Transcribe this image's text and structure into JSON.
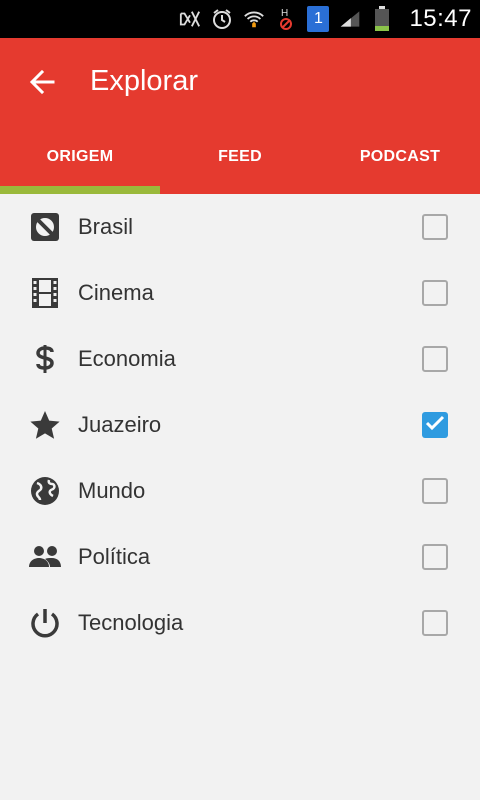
{
  "status_bar": {
    "time": "15:47",
    "icons": [
      "mute-icon",
      "alarm-icon",
      "wifi-icon",
      "h-data-icon",
      "sim-icon",
      "signal-icon",
      "battery-icon"
    ],
    "sim_label": "1",
    "data_label": "H"
  },
  "app_bar": {
    "title": "Explorar",
    "background": "#e53a2f"
  },
  "tabs": [
    {
      "label": "ORIGEM",
      "active": true
    },
    {
      "label": "FEED",
      "active": false
    },
    {
      "label": "PODCAST",
      "active": false
    }
  ],
  "list": {
    "items": [
      {
        "label": "Brasil",
        "icon": "soccer-ball-icon",
        "checked": false
      },
      {
        "label": "Cinema",
        "icon": "film-icon",
        "checked": false
      },
      {
        "label": "Economia",
        "icon": "dollar-icon",
        "checked": false
      },
      {
        "label": "Juazeiro",
        "icon": "star-icon",
        "checked": true
      },
      {
        "label": "Mundo",
        "icon": "globe-icon",
        "checked": false
      },
      {
        "label": "Política",
        "icon": "people-icon",
        "checked": false
      },
      {
        "label": "Tecnologia",
        "icon": "power-icon",
        "checked": false
      }
    ]
  },
  "colors": {
    "accent": "#e53a2f",
    "tab_indicator": "#9ab93b",
    "checkbox_checked": "#2f9be0",
    "background": "#f2f2f2"
  }
}
